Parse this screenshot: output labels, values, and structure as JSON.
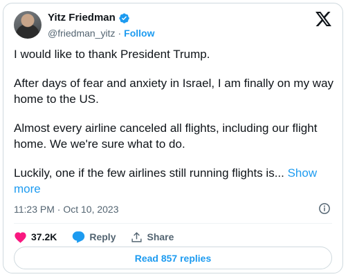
{
  "author": {
    "name": "Yitz Friedman",
    "handle": "@friedman_yitz",
    "separator": "·",
    "follow_label": "Follow"
  },
  "tweet": {
    "paragraphs": [
      "I would like to thank President Trump.",
      "After days of fear and anxiety in Israel, I am finally on my way home to the US.",
      "Almost every airline canceled all flights, including our flight home. We we're sure what to do."
    ],
    "last_paragraph": "Luckily, one if the few airlines still running flights is...",
    "show_more_label": "Show more",
    "timestamp": "11:23 PM · Oct 10, 2023"
  },
  "actions": {
    "likes": "37.2K",
    "reply_label": "Reply",
    "share_label": "Share"
  },
  "replies_button": "Read 857 replies",
  "colors": {
    "accent": "#1d9bf0",
    "like": "#f91880",
    "text": "#0f1419",
    "muted": "#536471",
    "border": "#cfd9de"
  },
  "icons": [
    "verified-badge-icon",
    "x-logo-icon",
    "info-icon",
    "heart-icon",
    "reply-icon",
    "share-icon"
  ]
}
